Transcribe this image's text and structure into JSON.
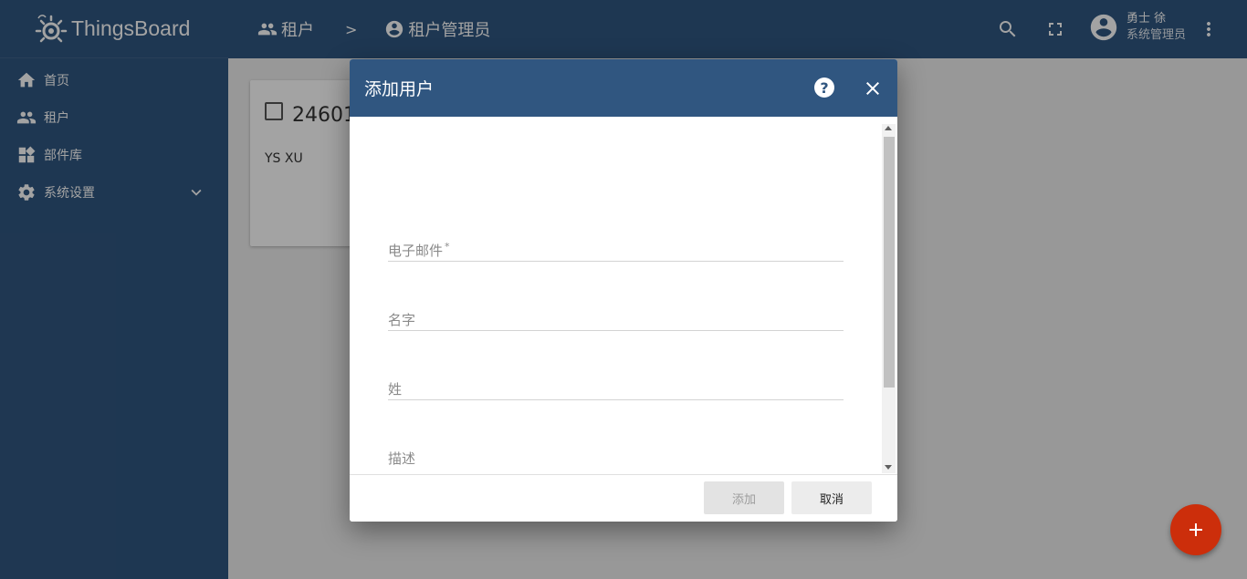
{
  "app": {
    "name": "ThingsBoard"
  },
  "sidebar": {
    "items": [
      {
        "label": "首页",
        "icon": "home-icon"
      },
      {
        "label": "租户",
        "icon": "people-icon"
      },
      {
        "label": "部件库",
        "icon": "widgets-icon"
      },
      {
        "label": "系统设置",
        "icon": "gear-icon",
        "expandable": true
      }
    ]
  },
  "header": {
    "breadcrumb": [
      {
        "label": "租户",
        "icon": "people-icon"
      },
      {
        "label": "租户管理员",
        "icon": "account-circle-icon"
      }
    ],
    "separator": ">",
    "user": {
      "name": "勇士 徐",
      "role": "系统管理员"
    }
  },
  "card": {
    "title": "24601",
    "subtitle": "YS XU"
  },
  "dialog": {
    "title": "添加用户",
    "help_symbol": "?",
    "fields": {
      "email": {
        "label": "电子邮件",
        "required_mark": "*",
        "value": ""
      },
      "first_name": {
        "label": "名字",
        "value": ""
      },
      "last_name": {
        "label": "姓",
        "value": ""
      },
      "description": {
        "label": "描述",
        "value": ""
      }
    },
    "buttons": {
      "add": "添加",
      "cancel": "取消"
    }
  },
  "colors": {
    "primary": "#305680",
    "accent": "#cc2e0b"
  }
}
